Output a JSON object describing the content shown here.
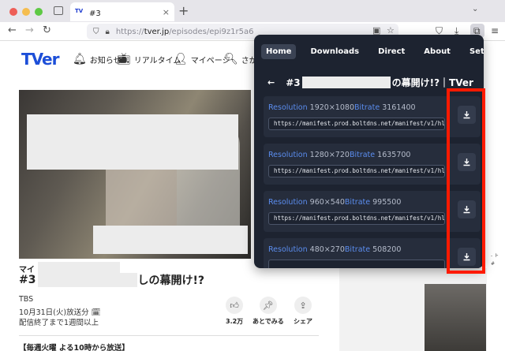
{
  "browser": {
    "tab_title": "#3　　　　　　　　　の幕開け!?",
    "favicon_text": "TV",
    "tab_close": "×",
    "new_tab": "+",
    "tab_list": "⌄",
    "url_scheme": "https://",
    "url_host": "tver.jp",
    "url_path": "/episodes/epi9z1r5a6",
    "back": "←",
    "forward": "→",
    "reload": "↻",
    "traffic_lights": [
      "#ee5e57",
      "#f5bd4f",
      "#5ec944"
    ]
  },
  "site": {
    "logo": "TVer",
    "nav": [
      {
        "icon": "bell-icon",
        "glyph": "🔔︎",
        "label": "お知らせ"
      },
      {
        "icon": "tv-icon",
        "glyph": "📺︎",
        "label": "リアルタイム"
      },
      {
        "icon": "person-icon",
        "glyph": "👤︎",
        "label": "マイページ"
      },
      {
        "icon": "search-icon",
        "glyph": "🔍︎",
        "label": "さが"
      }
    ],
    "show_prefix": "マイ",
    "episode_num": "#3",
    "episode_suffix": "しの幕開け!?",
    "broadcaster": "TBS",
    "air_date": "10月31日(火)放送分",
    "availability": "配信終了まで1週間以上",
    "actions": [
      {
        "icon": "thumbs-up-icon",
        "glyph": "👍︎",
        "label": "3.2万"
      },
      {
        "icon": "pin-icon",
        "glyph": "📌︎",
        "label": "あとでみる"
      },
      {
        "icon": "share-icon",
        "glyph": "⇪",
        "label": "シェア"
      }
    ],
    "schedule": "【毎週火曜 よる10時から放送】"
  },
  "popup": {
    "tabs": [
      "Home",
      "Downloads",
      "Direct",
      "About",
      "Settings"
    ],
    "active_tab": "Home",
    "back_arrow": "←",
    "title_prefix": "#3",
    "title_suffix": "の幕開け!?｜TVer",
    "streams": [
      {
        "resolution_label": "Resolution",
        "resolution": "1920×1080",
        "bitrate_label": "Bitrate",
        "bitrate": "3161400",
        "url": "https://manifest.prod.boltdns.net/manifest/v1/hls/v4/aes1"
      },
      {
        "resolution_label": "Resolution",
        "resolution": "1280×720",
        "bitrate_label": "Bitrate",
        "bitrate": "1635700",
        "url": "https://manifest.prod.boltdns.net/manifest/v1/hls/v4/aes1"
      },
      {
        "resolution_label": "Resolution",
        "resolution": "960×540",
        "bitrate_label": "Bitrate",
        "bitrate": "995500",
        "url": "https://manifest.prod.boltdns.net/manifest/v1/hls/v4/aes1"
      },
      {
        "resolution_label": "Resolution",
        "resolution": "480×270",
        "bitrate_label": "Bitrate",
        "bitrate": "508200",
        "url": ""
      }
    ]
  },
  "side_label": [
    "- ト",
    "#"
  ],
  "colors": {
    "popup_bg": "#1d2330",
    "accent_blue": "#5b8def",
    "highlight_red": "#ff1a00",
    "logo_blue": "#1d4fd8"
  }
}
